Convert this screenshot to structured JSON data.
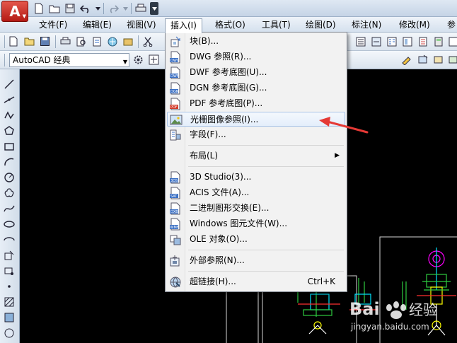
{
  "app": {
    "logo_letter": "A"
  },
  "menubar": {
    "items": [
      "文件(F)",
      "编辑(E)",
      "视图(V)",
      "插入(I)",
      "格式(O)",
      "工具(T)",
      "绘图(D)",
      "标注(N)",
      "修改(M)",
      "参"
    ],
    "active_index": 3
  },
  "workspace": {
    "selected": "AutoCAD 经典"
  },
  "insert_menu": {
    "items": [
      {
        "label": "块(B)...",
        "icon": "block-insert-icon"
      },
      {
        "label": "DWG 参照(R)...",
        "icon": "dwg-file-icon"
      },
      {
        "label": "DWF 参考底图(U)...",
        "icon": "dwf-file-icon"
      },
      {
        "label": "DGN 参考底图(G)...",
        "icon": "dgn-file-icon"
      },
      {
        "label": "PDF 参考底图(P)...",
        "icon": "pdf-file-icon"
      },
      {
        "label": "光栅图像参照(I)...",
        "icon": "raster-image-icon"
      },
      {
        "label": "字段(F)...",
        "icon": "field-icon"
      },
      {
        "label": "布局(L)",
        "icon": "",
        "submenu": true
      },
      {
        "label": "3D Studio(3)...",
        "icon": "3ds-file-icon"
      },
      {
        "label": "ACIS 文件(A)...",
        "icon": "acis-file-icon"
      },
      {
        "label": "二进制图形交换(E)...",
        "icon": "dxb-file-icon"
      },
      {
        "label": "Windows 图元文件(W)...",
        "icon": "wmf-file-icon"
      },
      {
        "label": "OLE 对象(O)...",
        "icon": "ole-object-icon"
      },
      {
        "label": "外部参照(N)...",
        "icon": "xref-icon"
      },
      {
        "label": "超链接(H)...",
        "icon": "hyperlink-icon",
        "shortcut": "Ctrl+K"
      }
    ],
    "highlighted_index": 5
  },
  "watermark": {
    "brand": "Bai",
    "brand_cn": "经验",
    "url": "jingyan.baidu.com"
  },
  "colors": {
    "accent_red": "#e53935",
    "canvas": "#000000",
    "cad_green": "#2ecc40",
    "cad_magenta": "#ff00ff",
    "cad_cyan": "#00e5ff",
    "cad_yellow": "#ffff00"
  }
}
